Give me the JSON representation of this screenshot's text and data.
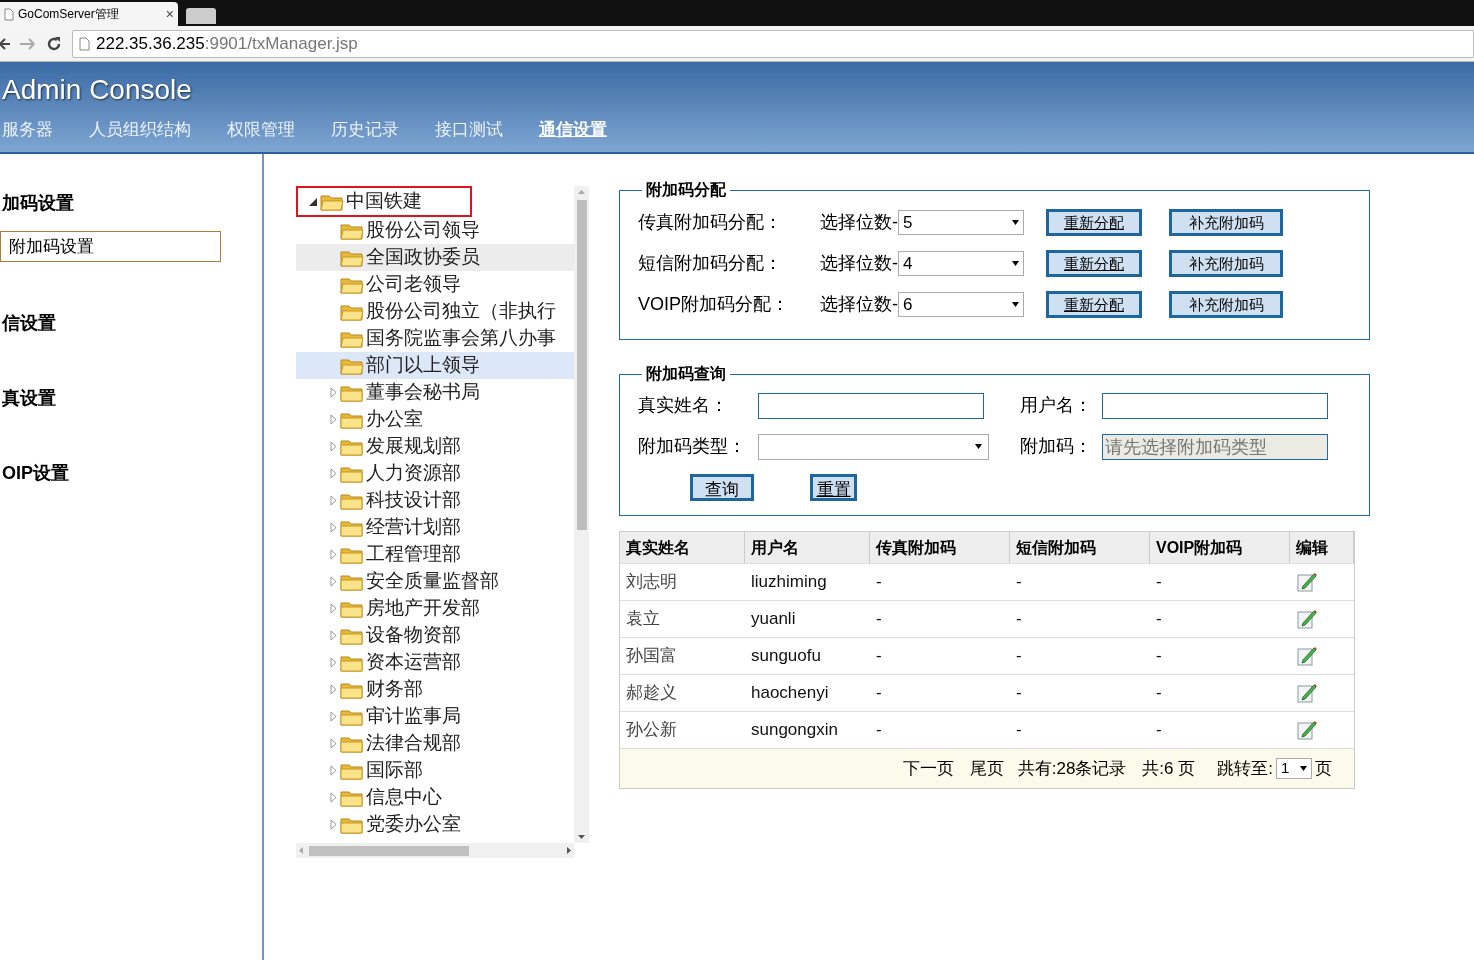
{
  "browser": {
    "tab_title": "GoComServer管理",
    "tab_close": "×",
    "url_host": "222.35.36.235",
    "url_path": ":9901/txManager.jsp"
  },
  "header": {
    "title": "Admin Console",
    "nav": [
      {
        "label": "服务器",
        "selected": false
      },
      {
        "label": "人员组织结构",
        "selected": false
      },
      {
        "label": "权限管理",
        "selected": false
      },
      {
        "label": "历史记录",
        "selected": false
      },
      {
        "label": "接口测试",
        "selected": false
      },
      {
        "label": "通信设置",
        "selected": true
      }
    ]
  },
  "sidebar": {
    "sections": [
      {
        "title": "加码设置",
        "items": [
          {
            "label": "附加码设置",
            "selected": true
          }
        ]
      },
      {
        "title": "信设置"
      },
      {
        "title": "真设置"
      },
      {
        "title": "OIP设置"
      }
    ]
  },
  "tree": {
    "root": {
      "label": "中国铁建",
      "expanded": true,
      "highlighted": true,
      "children": [
        {
          "label": "股份公司领导",
          "expandable": false,
          "selected": false,
          "hovered": false
        },
        {
          "label": "全国政协委员",
          "expandable": false,
          "selected": false,
          "hovered": true
        },
        {
          "label": "公司老领导",
          "expandable": false,
          "selected": false,
          "hovered": false
        },
        {
          "label": "股份公司独立（非执行",
          "expandable": false,
          "selected": false,
          "hovered": false
        },
        {
          "label": "国务院监事会第八办事",
          "expandable": false,
          "selected": false,
          "hovered": false
        },
        {
          "label": "部门以上领导",
          "expandable": false,
          "selected": true,
          "hovered": false
        },
        {
          "label": "董事会秘书局",
          "expandable": true,
          "selected": false,
          "hovered": false
        },
        {
          "label": "办公室",
          "expandable": true,
          "selected": false,
          "hovered": false
        },
        {
          "label": "发展规划部",
          "expandable": true,
          "selected": false,
          "hovered": false
        },
        {
          "label": "人力资源部",
          "expandable": true,
          "selected": false,
          "hovered": false
        },
        {
          "label": "科技设计部",
          "expandable": true,
          "selected": false,
          "hovered": false
        },
        {
          "label": "经营计划部",
          "expandable": true,
          "selected": false,
          "hovered": false
        },
        {
          "label": "工程管理部",
          "expandable": true,
          "selected": false,
          "hovered": false
        },
        {
          "label": "安全质量监督部",
          "expandable": true,
          "selected": false,
          "hovered": false
        },
        {
          "label": "房地产开发部",
          "expandable": true,
          "selected": false,
          "hovered": false
        },
        {
          "label": "设备物资部",
          "expandable": true,
          "selected": false,
          "hovered": false
        },
        {
          "label": "资本运营部",
          "expandable": true,
          "selected": false,
          "hovered": false
        },
        {
          "label": "财务部",
          "expandable": true,
          "selected": false,
          "hovered": false
        },
        {
          "label": "审计监事局",
          "expandable": true,
          "selected": false,
          "hovered": false
        },
        {
          "label": "法律合规部",
          "expandable": true,
          "selected": false,
          "hovered": false
        },
        {
          "label": "国际部",
          "expandable": true,
          "selected": false,
          "hovered": false
        },
        {
          "label": "信息中心",
          "expandable": true,
          "selected": false,
          "hovered": false
        },
        {
          "label": "党委办公室",
          "expandable": true,
          "selected": false,
          "hovered": false
        }
      ]
    }
  },
  "allocation": {
    "legend": "附加码分配",
    "rows": [
      {
        "label": "传真附加码分配：",
        "digits_label": "选择位数-",
        "value": "5",
        "buttons": [
          "重新分配",
          "补充附加码"
        ]
      },
      {
        "label": "短信附加码分配：",
        "digits_label": "选择位数-",
        "value": "4",
        "buttons": [
          "重新分配",
          "补充附加码"
        ]
      },
      {
        "label": "VOIP附加码分配：",
        "digits_label": "选择位数-",
        "value": "6",
        "buttons": [
          "重新分配",
          "补充附加码"
        ]
      }
    ]
  },
  "query": {
    "legend": "附加码查询",
    "fields": [
      {
        "label": "真实姓名：",
        "kind": "text"
      },
      {
        "label": "用户名：",
        "kind": "text"
      },
      {
        "label": "附加码类型：",
        "kind": "select"
      },
      {
        "label": "附加码：",
        "kind": "disabled",
        "placeholder": "请先选择附加码类型"
      }
    ],
    "buttons": [
      "查询",
      "重置"
    ]
  },
  "table": {
    "columns": [
      "真实姓名",
      "用户名",
      "传真附加码",
      "短信附加码",
      "VOIP附加码",
      "编辑"
    ],
    "rows": [
      {
        "cells": [
          "刘志明",
          "liuzhiming",
          "-",
          "-",
          "-"
        ]
      },
      {
        "cells": [
          "袁立",
          "yuanli",
          "-",
          "-",
          "-"
        ]
      },
      {
        "cells": [
          "孙国富",
          "sunguofu",
          "-",
          "-",
          "-"
        ]
      },
      {
        "cells": [
          "郝趁义",
          "haochenyi",
          "-",
          "-",
          "-"
        ]
      },
      {
        "cells": [
          "孙公新",
          "sungongxin",
          "-",
          "-",
          "-"
        ]
      }
    ]
  },
  "pagination": {
    "links": [
      "下一页",
      "尾页"
    ],
    "total": "共有:28条记录",
    "pages": "共:6 页",
    "jump_label": "跳转至:",
    "page_value": "1",
    "suffix": "页"
  }
}
